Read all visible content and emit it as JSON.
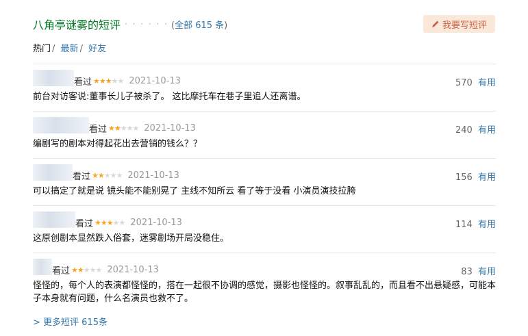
{
  "header": {
    "title": "八角亭谜雾的短评",
    "dots": "· · · · · ·",
    "total_open": "(",
    "total_link": "全部 615 条",
    "total_close": ")"
  },
  "write_button": {
    "label": "我要写短评",
    "icon": "pencil-icon"
  },
  "tabs": [
    {
      "label": "热门",
      "active": true
    },
    {
      "label": "最新",
      "active": false
    },
    {
      "label": "好友",
      "active": false
    }
  ],
  "tab_separator": "/",
  "comments": [
    {
      "watched": "看过",
      "rating": 3,
      "date": "2021-10-13",
      "votes": "570",
      "vote_label": "有用",
      "text": "前台对访客说:董事长儿子被杀了。 这比摩托车在巷子里追人还离谱。"
    },
    {
      "watched": "看过",
      "rating": 2,
      "date": "2021-10-13",
      "votes": "240",
      "vote_label": "有用",
      "text": "编剧写的剧本对得起花出去营销的钱么？？"
    },
    {
      "watched": "看过",
      "rating": 2,
      "date": "2021-10-13",
      "votes": "156",
      "vote_label": "有用",
      "text": "可以搞定了就是说 镜头能不能别晃了 主线不知所云 看了等于没看 小演员演技拉胯"
    },
    {
      "watched": "看过",
      "rating": 3,
      "date": "2021-10-13",
      "votes": "114",
      "vote_label": "有用",
      "text": "这原创剧本显然跌入俗套，迷雾剧场开局没稳住。"
    },
    {
      "watched": "看过",
      "rating": 2,
      "date": "2021-10-13",
      "votes": "83",
      "vote_label": "有用",
      "text": "怪怪的，每个人的表演都怪怪的，搭在一起很不协调的感觉，摄影也怪怪的。叙事乱乱的，而且看不出悬疑感，可能本子本身就有问题，什么名演员也救不了。"
    }
  ],
  "more": {
    "label": "> 更多短评 615条"
  },
  "colors": {
    "green_title": "#007722",
    "link": "#3377aa",
    "star": "#f5a623",
    "button_bg": "#fae9da",
    "button_text": "#ca6445"
  }
}
